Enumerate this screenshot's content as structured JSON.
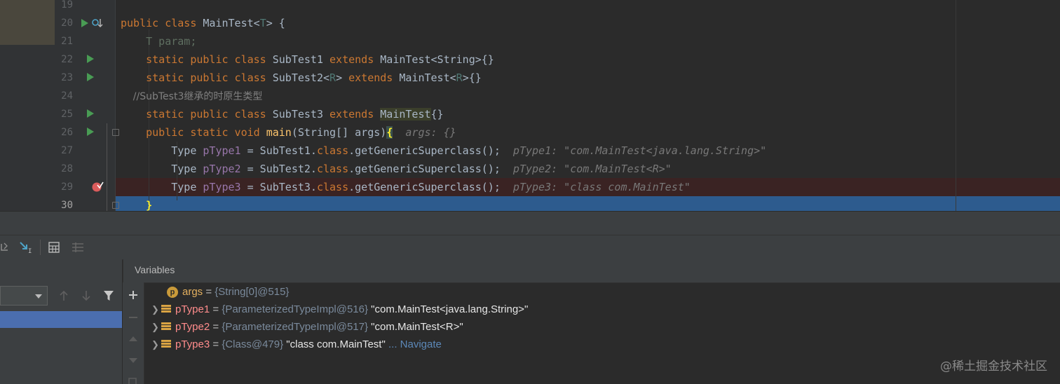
{
  "editor": {
    "line_numbers": [
      "19",
      "20",
      "21",
      "22",
      "23",
      "24",
      "25",
      "26",
      "27",
      "28",
      "29",
      "30"
    ],
    "lines": {
      "l20": {
        "k1": "public class ",
        "cls": "MainTest<",
        "tp": "T",
        "rest": "> {"
      },
      "l21": {
        "text": "    T param;"
      },
      "l22": {
        "k1": "    static public class ",
        "cls": "SubTest1 ",
        "k2": "extends ",
        "rest": "MainTest<String>{}"
      },
      "l23": {
        "k1": "    static public class ",
        "cls": "SubTest2<",
        "tp": "R",
        "mid": "> ",
        "k2": "extends ",
        "rest": "MainTest<",
        "tp2": "R",
        "rest2": ">{}"
      },
      "l24": {
        "comment": "    //SubTest3继承的时原生类型"
      },
      "l25": {
        "k1": "    static public class ",
        "cls": "SubTest3 ",
        "k2": "extends ",
        "hl": "MainTest",
        "rest": "{}"
      },
      "l26": {
        "k1": "    public static void ",
        "fn": "main",
        "rest": "(String[] args)",
        "brace": "{",
        "hint": "  args: {}"
      },
      "l27": {
        "a": "        Type ",
        "v": "pType1",
        "b": " = SubTest1.",
        "k": "class",
        "c": ".getGenericSuperclass();",
        "hint": "  pType1: \"com.MainTest<java.lang.String>\""
      },
      "l28": {
        "a": "        Type ",
        "v": "pType2",
        "b": " = SubTest2.",
        "k": "class",
        "c": ".getGenericSuperclass();",
        "hint": "  pType2: \"com.MainTest<R>\""
      },
      "l29": {
        "a": "        Type ",
        "v": "pType3",
        "b": " = SubTest3.",
        "k": "class",
        "c": ".getGenericSuperclass();",
        "hint": "  pType3: \"class com.MainTest\""
      },
      "l30": {
        "brace": "    }"
      }
    }
  },
  "debug": {
    "variables_title": "Variables",
    "variables": [
      {
        "name": "args",
        "eq": " = ",
        "type": "{String[0]@515}",
        "value": "",
        "kind": "param",
        "icon_letter": "p"
      },
      {
        "name": "pType1",
        "eq": " = ",
        "type": "{ParameterizedTypeImpl@516} ",
        "value": "\"com.MainTest<java.lang.String>\"",
        "kind": "field"
      },
      {
        "name": "pType2",
        "eq": " = ",
        "type": "{ParameterizedTypeImpl@517} ",
        "value": "\"com.MainTest<R>\"",
        "kind": "field"
      },
      {
        "name": "pType3",
        "eq": " = ",
        "type": "{Class@479} ",
        "value": "\"class com.MainTest\"",
        "nav": " ... Navigate",
        "kind": "field"
      }
    ]
  },
  "watermark": "@稀土掘金技术社区",
  "colors": {
    "accent": "#4b6eaf",
    "current_line": "#2d5b8e",
    "breakpoint": "#db5c5c",
    "run": "#499c54"
  }
}
